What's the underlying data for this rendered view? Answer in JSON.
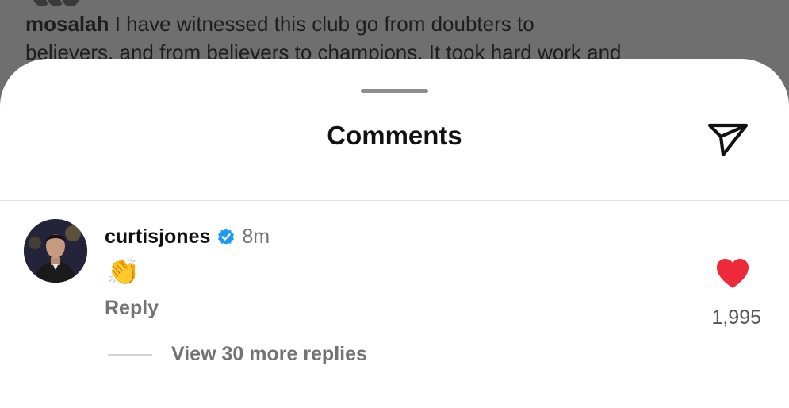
{
  "post": {
    "caption_user": "mosalah",
    "caption_line1": "I have witnessed this club go from doubters to",
    "caption_line2": "believers, and from believers to champions. It took hard work and"
  },
  "sheet": {
    "title": "Comments",
    "share_icon": "send-icon"
  },
  "comments": [
    {
      "username": "curtisjones",
      "verified": true,
      "time": "8m",
      "text": "👏",
      "reply_label": "Reply",
      "like_icon": "heart-filled-icon",
      "like_count": "1,995",
      "view_replies_label": "View 30 more replies"
    }
  ],
  "colors": {
    "like": "#ed2a3a",
    "verified": "#1d9bf0",
    "muted_text": "#737373",
    "backdrop": "#6f6f6f"
  }
}
